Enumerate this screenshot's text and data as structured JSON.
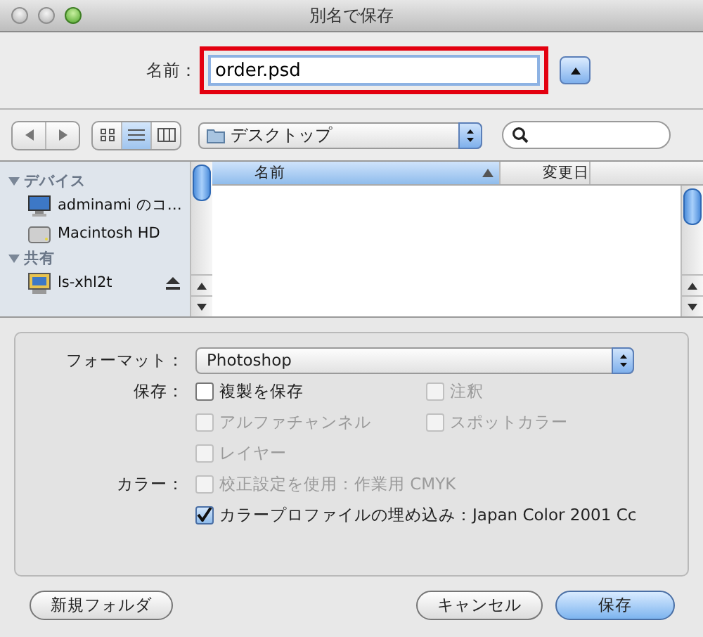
{
  "window": {
    "title": "別名で保存"
  },
  "name_field": {
    "label": "名前：",
    "value": "order.psd",
    "highlighted": true
  },
  "toolbar": {
    "location": "デスクトップ",
    "views": [
      {
        "kind": "icon",
        "selected": false
      },
      {
        "kind": "list",
        "selected": true
      },
      {
        "kind": "column",
        "selected": false
      }
    ]
  },
  "sidebar": {
    "sections": [
      {
        "title": "デバイス",
        "expanded": true,
        "items": [
          {
            "label": "adminami のコ…",
            "kind": "computer",
            "eject": false
          },
          {
            "label": "Macintosh HD",
            "kind": "disk",
            "eject": false
          }
        ]
      },
      {
        "title": "共有",
        "expanded": true,
        "items": [
          {
            "label": "ls-xhl2t",
            "kind": "server",
            "eject": true
          }
        ]
      }
    ]
  },
  "file_list": {
    "columns": [
      {
        "label": "名前",
        "sorted": true
      },
      {
        "label": "変更日",
        "sorted": false
      }
    ]
  },
  "options": {
    "format_label": "フォーマット：",
    "format": "Photoshop",
    "rows": [
      {
        "label": "保存：",
        "items": [
          {
            "label": "複製を保存",
            "checked": false,
            "disabled": false
          },
          {
            "label": "注釈",
            "checked": false,
            "disabled": true
          }
        ]
      },
      {
        "items": [
          {
            "label": "アルファチャンネル",
            "checked": false,
            "disabled": true
          },
          {
            "label": "スポットカラー",
            "checked": false,
            "disabled": true
          }
        ]
      },
      {
        "items": [
          {
            "label": "レイヤー",
            "checked": false,
            "disabled": true
          }
        ]
      },
      {
        "label": "カラー：",
        "items": [
          {
            "label": "校正設定を使用：作業用 CMYK",
            "checked": false,
            "disabled": true
          }
        ]
      },
      {
        "items": [
          {
            "label": "カラープロファイルの埋め込み：Japan Color 2001 Cc",
            "checked": true,
            "disabled": false
          }
        ]
      }
    ]
  },
  "buttons": [
    {
      "label": "新規フォルダ",
      "kind": "secondary"
    },
    {
      "label": "キャンセル",
      "kind": "secondary"
    },
    {
      "label": "保存",
      "kind": "default"
    }
  ]
}
